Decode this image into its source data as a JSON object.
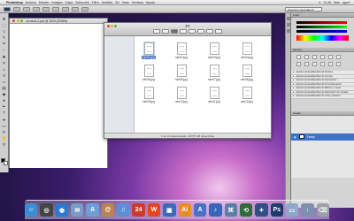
{
  "menubar": {
    "apple": "",
    "app": "Photoshop",
    "items": [
      "Archivo",
      "Edición",
      "Imagen",
      "Capa",
      "Selección",
      "Filtro",
      "Análisis",
      "3D",
      "Vista",
      "Ventana",
      "Ayuda"
    ],
    "right": [
      "4",
      "12:45",
      "Mac",
      "agm7"
    ]
  },
  "options": {
    "workspace": "Aspectos esenciales ▾"
  },
  "document": {
    "title": "sin título-1.psd @ 100% (RGB/8)"
  },
  "finder": {
    "title": "jpg",
    "files": [
      "sim01.jpg",
      "sim02.jpg",
      "sim03.jpg",
      "sim04.jpg",
      "sim05.jpg",
      "sim06.jpg",
      "sim07.jpg",
      "sim08.jpg",
      "sim09.jpg",
      "sim10.jpg",
      "sim11.jpg",
      "sim12.jpg"
    ],
    "selected_index": 0,
    "status": "1 de 19 seleccionado, 110,55 GB disponibles"
  },
  "panels": {
    "color_tab": "Color",
    "adjust_tab": "Ajustes",
    "presets": [
      "Ajustes preestablecidos de Niveles",
      "Ajustes preestablecidos de Curvas",
      "Ajustes preestablecidos de Exposición",
      "Ajustes preestablecidos de Tono/saturación",
      "Ajustes preestablecidos de Blanco y negro",
      "Ajustes preestablecidos de Mezclador de canales",
      "Ajustes preestablecidos de Color selectivo"
    ],
    "layers_tab": "Capas",
    "layer_name": "Fondo"
  },
  "dock": [
    {
      "name": "finder-icon",
      "glyph": "☺",
      "color": "#3d8cd6"
    },
    {
      "name": "dashboard-icon",
      "glyph": "◎",
      "color": "#444444"
    },
    {
      "name": "safari-icon",
      "glyph": "◉",
      "color": "#2b7ad1"
    },
    {
      "name": "mail-icon",
      "glyph": "✉",
      "color": "#7a9cc8"
    },
    {
      "name": "ichat-icon",
      "glyph": "A",
      "color": "#6aa0d6"
    },
    {
      "name": "addressbook-icon",
      "glyph": "@",
      "color": "#b8864a"
    },
    {
      "name": "itunes-icon",
      "glyph": "♫",
      "color": "#5b8fd8"
    },
    {
      "name": "ical-icon",
      "glyph": "24",
      "color": "#d03a2a"
    },
    {
      "name": "w-app-icon",
      "glyph": "W",
      "color": "#e2461f"
    },
    {
      "name": "photos-icon",
      "glyph": "▣",
      "color": "#3b6ab6"
    },
    {
      "name": "illustrator-icon",
      "glyph": "Ai",
      "color": "#ea8d1e"
    },
    {
      "name": "appstore-icon",
      "glyph": "A",
      "color": "#4a72c4"
    },
    {
      "name": "itunes-note-icon",
      "glyph": "♪",
      "color": "#3a66b8"
    },
    {
      "name": "preview-icon",
      "glyph": "⌘",
      "color": "#5a7fa6"
    },
    {
      "name": "timemachine-icon",
      "glyph": "⟲",
      "color": "#2f6b3a"
    },
    {
      "name": "compass-icon",
      "glyph": "✦",
      "color": "#2f4f86"
    },
    {
      "name": "photoshop-icon",
      "glyph": "Ps",
      "color": "#1d3b6b"
    },
    {
      "name": "folder-icon",
      "glyph": "▭",
      "color": "#8ea8cc"
    },
    {
      "name": "downloads-icon",
      "glyph": "↓",
      "color": "#7e8fb0"
    },
    {
      "name": "trash-icon",
      "glyph": "⌫",
      "color": "#9aa0a8"
    }
  ],
  "colors": {
    "selection": "#3d72c9",
    "close": "#e0453b",
    "min": "#e5b12d",
    "max": "#5bb53a"
  }
}
